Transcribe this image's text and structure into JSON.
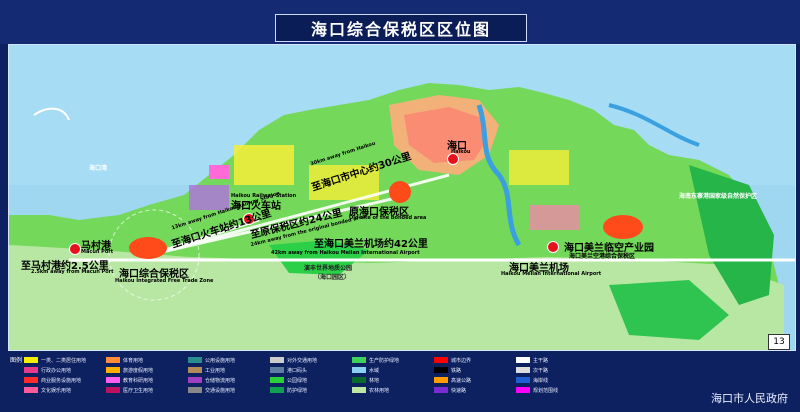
{
  "title": "海口综合保税区区位图",
  "page_number": "13",
  "footer": "海口市人民政府",
  "labels": {
    "haikou": {
      "cn": "海口",
      "en": "Haikou"
    },
    "meilan_park": {
      "cn": "海口美兰临空产业园"
    },
    "meilan_airport": {
      "cn": "海口美兰机场",
      "en": "Haikou Meilan International Airport"
    },
    "ftz": {
      "cn": "海口综合保税区",
      "en": "Haikou Integrated Free Trade Zone"
    },
    "macun": {
      "cn": "马村港",
      "en": "Macun Port"
    },
    "macun_dist": {
      "cn": "至马村港约2.5公里",
      "en": "2.5km away from Macun Port"
    },
    "rail_station": {
      "cn": "海口火车站",
      "en": "Haikou Railway Station"
    },
    "rail_dist": {
      "cn": "至海口火车站约13公里",
      "en": "13km away from Haikou Railway Station"
    },
    "old_site": {
      "cn": "原海口保税区",
      "en": "Old site of the bonded area"
    },
    "old_dist": {
      "cn": "至原保税区约24公里",
      "en": "24km away from the original bonded area"
    },
    "center_dist": {
      "cn": "至海口市中心约30公里",
      "en": "30km away from Haikou"
    },
    "airport_dist": {
      "cn": "至海口美兰机场约42公里",
      "en": "42km away from Haikou Meilan International Airport"
    },
    "world_park": {
      "cn": "演丰世界地质公园",
      "en": "（海口园区）"
    },
    "meilan_area": {
      "cn": "海口美兰空港综合保税区"
    },
    "east_reserve": {
      "cn": "海南东寨港国家级自然保护区"
    },
    "haikou_bay": {
      "cn": "海口湾"
    }
  },
  "legend": {
    "title": "图例",
    "items": [
      {
        "label": "一类、二类居住用地",
        "color": "#f5f000"
      },
      {
        "label": "行政办公用地",
        "color": "#e63b8a"
      },
      {
        "label": "商业服务设施用地",
        "color": "#ff2b2b"
      },
      {
        "label": "文化娱乐用地",
        "color": "#ff5a9a"
      },
      {
        "label": "体育用地",
        "color": "#ff8c3a"
      },
      {
        "label": "旅游度假用地",
        "color": "#ffb000"
      },
      {
        "label": "教育科研用地",
        "color": "#ff5cf0"
      },
      {
        "label": "医疗卫生用地",
        "color": "#c01060"
      },
      {
        "label": "公用设施用地",
        "color": "#2a8c8c"
      },
      {
        "label": "工业用地",
        "color": "#b38a5a"
      },
      {
        "label": "仓储物流用地",
        "color": "#a040c0"
      },
      {
        "label": "交通设施用地",
        "color": "#888888"
      },
      {
        "label": "对外交通用地",
        "color": "#cccccc"
      },
      {
        "label": "港口码头",
        "color": "#5f7da0"
      },
      {
        "label": "公园绿地",
        "color": "#2bd13a"
      },
      {
        "label": "防护绿地",
        "color": "#11a050"
      },
      {
        "label": "生产防护绿地",
        "color": "#3ed15c"
      },
      {
        "label": "水域",
        "color": "#8ad0f0"
      },
      {
        "label": "林地",
        "color": "#0b6b2b"
      },
      {
        "label": "农林用地",
        "color": "#bfe6a3"
      },
      {
        "label": "城市边界",
        "color": "#ff0000"
      },
      {
        "label": "铁路",
        "color": "#000000"
      },
      {
        "label": "高速公路",
        "color": "#ff9c00"
      },
      {
        "label": "快速路",
        "color": "#7a2bd1"
      },
      {
        "label": "主干路",
        "color": "#ffffff"
      },
      {
        "label": "次干路",
        "color": "#dddddd"
      },
      {
        "label": "海岸线",
        "color": "#1f5fd1"
      },
      {
        "label": "规划范围线",
        "color": "#ff00ff"
      }
    ]
  }
}
